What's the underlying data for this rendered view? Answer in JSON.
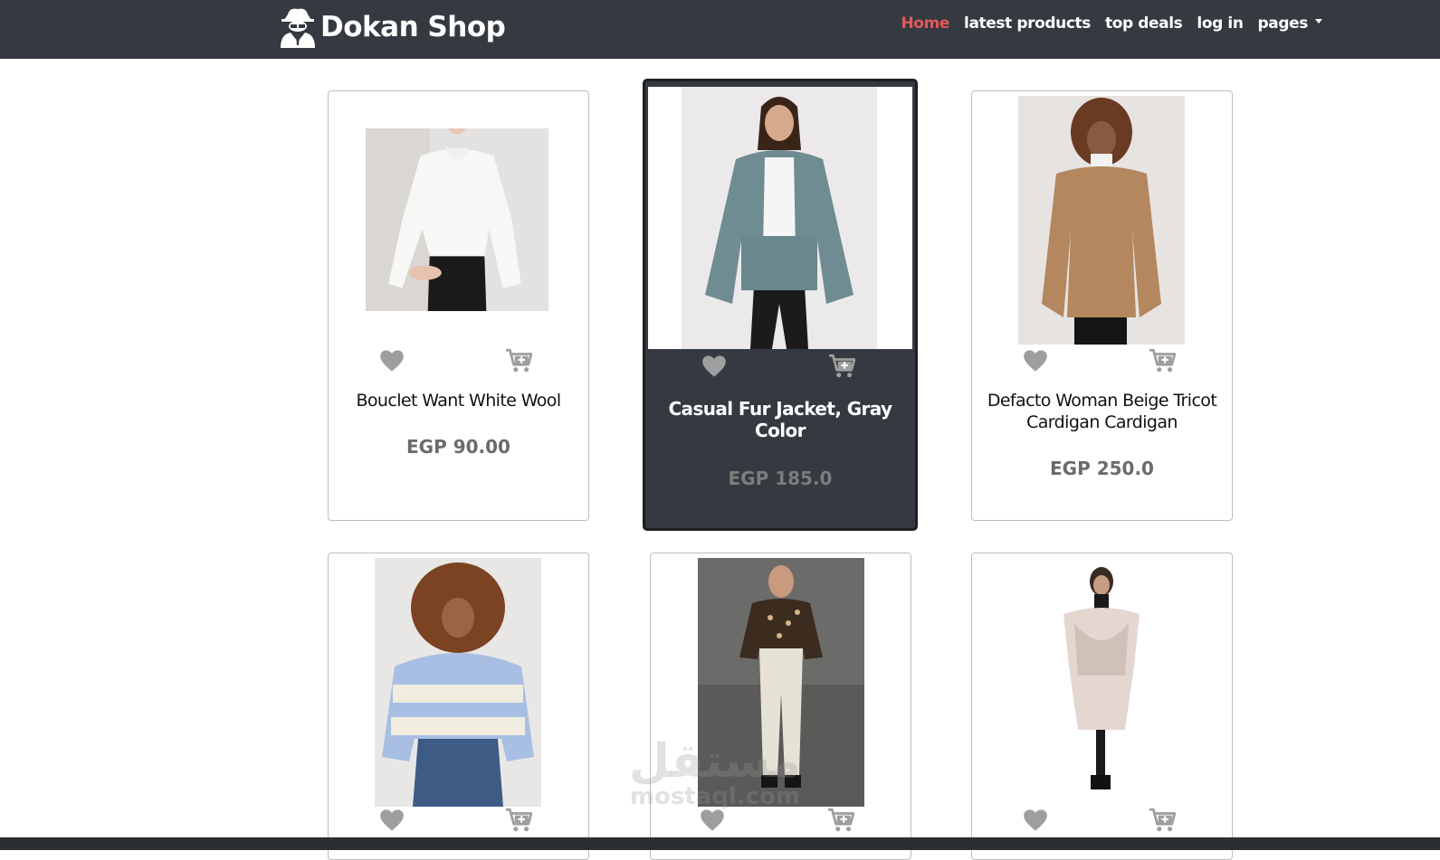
{
  "brand": {
    "name": "Dokan Shop",
    "icon": "spy-icon"
  },
  "nav": {
    "links": [
      {
        "label": "Home",
        "active": true
      },
      {
        "label": "latest products",
        "active": false
      },
      {
        "label": "top deals",
        "active": false
      },
      {
        "label": "log in",
        "active": false
      },
      {
        "label": "pages",
        "active": false,
        "dropdown": true
      }
    ]
  },
  "products": [
    {
      "name": "Bouclet Want White Wool",
      "price": "EGP 90.00",
      "image": "white-sweater-photo"
    },
    {
      "name": "Casual Fur Jacket, Gray Color",
      "price": "EGP 185.0",
      "image": "gray-fur-jacket-photo",
      "highlighted": true
    },
    {
      "name": "Defacto Woman Beige Tricot Cardigan Cardigan",
      "price": "EGP 250.0",
      "image": "beige-cardigan-photo"
    },
    {
      "name": "",
      "price": "",
      "image": "striped-sweater-photo"
    },
    {
      "name": "",
      "price": "",
      "image": "leopard-blouse-photo"
    },
    {
      "name": "",
      "price": "",
      "image": "beige-poncho-photo"
    }
  ],
  "watermark": {
    "arabic": "مستقل",
    "latin": "mostaql.com"
  },
  "colors": {
    "navbar": "#343a40",
    "active_link": "#e05a5a",
    "icon_gray": "#9e9e9e",
    "price_gray": "#6b6b6b"
  }
}
